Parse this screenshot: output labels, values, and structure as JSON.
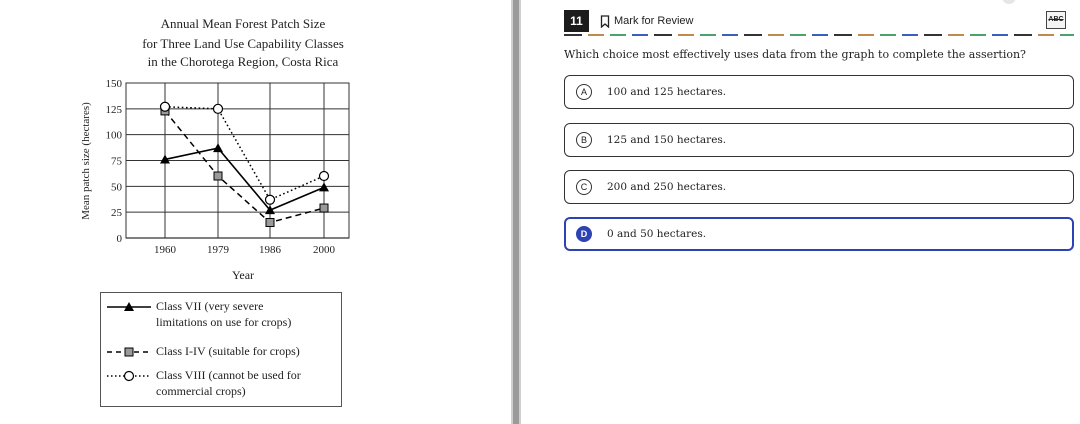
{
  "chart_data": {
    "type": "line",
    "title": "Annual Mean Forest Patch Size",
    "subtitle_lines": [
      "for Three Land Use Capability Classes",
      "in the Chorotega Region, Costa Rica"
    ],
    "xlabel": "Year",
    "ylabel": "Mean patch size (hectares)",
    "x": [
      "1960",
      "1979",
      "1986",
      "2000"
    ],
    "y_ticks": [
      0,
      25,
      50,
      75,
      100,
      125,
      150
    ],
    "ylim": [
      0,
      150
    ],
    "grid": true,
    "legend_position": "bottom",
    "series": [
      {
        "name": "Class VII (very severe limitations on use for crops)",
        "name_lines": [
          "Class VII (very severe",
          "limitations on use for crops)"
        ],
        "values": [
          76,
          87,
          27,
          49
        ],
        "line_style": "solid",
        "marker": "filled-triangle",
        "color": "#000000"
      },
      {
        "name": "Class I-IV (suitable for crops)",
        "name_lines": [
          "Class I-IV (suitable for crops)"
        ],
        "values": [
          123,
          60,
          15,
          29
        ],
        "line_style": "dashed",
        "marker": "gray-square",
        "color": "#000000"
      },
      {
        "name": "Class VIII (cannot be used for commercial crops)",
        "name_lines": [
          "Class VIII (cannot be used for",
          "commercial crops)"
        ],
        "values": [
          127,
          125,
          37,
          60
        ],
        "line_style": "dotted",
        "marker": "open-circle",
        "color": "#000000"
      }
    ]
  },
  "question": {
    "number": "11",
    "mark_for_review": "Mark for Review",
    "bookmark_icon": "bookmark-icon",
    "abc_tool_label": "ABC",
    "prompt": "Which choice most effectively uses data from the graph to complete the assertion?",
    "options": [
      {
        "letter": "A",
        "text": "100 and 125 hectares.",
        "selected": false
      },
      {
        "letter": "B",
        "text": "125 and 150 hectares.",
        "selected": false
      },
      {
        "letter": "C",
        "text": "200 and 250 hectares.",
        "selected": false
      },
      {
        "letter": "D",
        "text": "0 and 50 hectares.",
        "selected": true
      }
    ],
    "selected_color": "#2e43b3"
  }
}
